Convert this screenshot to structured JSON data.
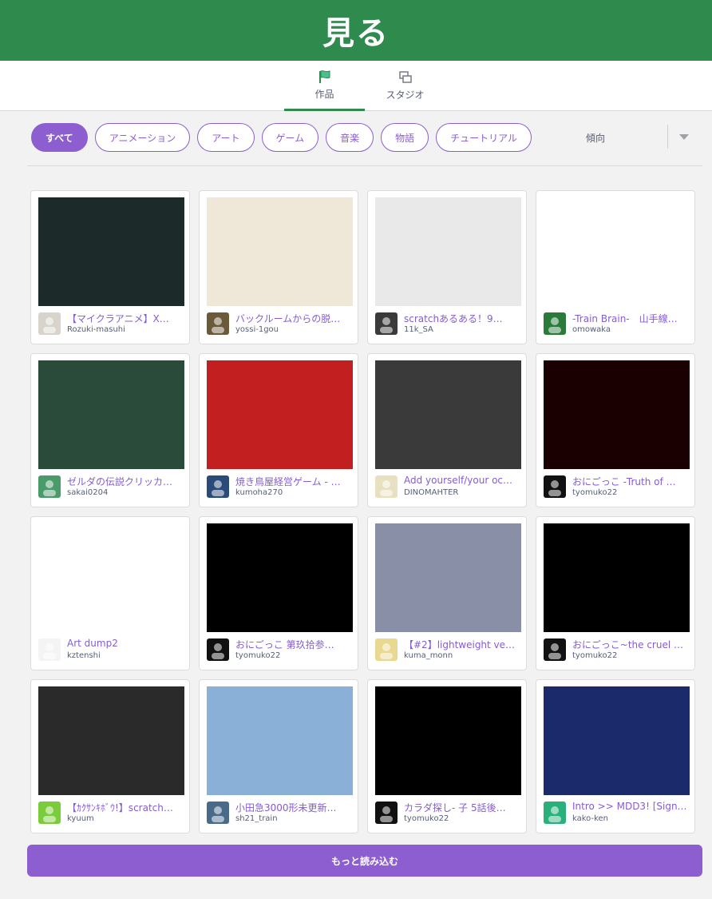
{
  "header": {
    "title": "見る"
  },
  "tabs": [
    {
      "label": "作品",
      "icon": "flag-icon",
      "active": true
    },
    {
      "label": "スタジオ",
      "icon": "studio-icon",
      "active": false
    }
  ],
  "filters": [
    {
      "label": "すべて",
      "active": true
    },
    {
      "label": "アニメーション",
      "active": false
    },
    {
      "label": "アート",
      "active": false
    },
    {
      "label": "ゲーム",
      "active": false
    },
    {
      "label": "音楽",
      "active": false
    },
    {
      "label": "物語",
      "active": false
    },
    {
      "label": "チュートリアル",
      "active": false
    }
  ],
  "sort": {
    "label": "傾向"
  },
  "projects": [
    {
      "title": "【マイクラアニメ】X…",
      "author": "Rozuki-masuhi",
      "thumb": "#1c2a2a",
      "avatar": "#d8d4cc"
    },
    {
      "title": "バックルームからの脱…",
      "author": "yossi-1gou",
      "thumb": "#efe8d8",
      "avatar": "#6b5a3a"
    },
    {
      "title": "scratchあるある！9…",
      "author": "11k_SA",
      "thumb": "#e9e9e9",
      "avatar": "#3a3a3a"
    },
    {
      "title": "-Train Brain-　山手線…",
      "author": "omowaka",
      "thumb": "#ffffff",
      "avatar": "#2a7a3a"
    },
    {
      "title": "ゼルダの伝説クリッカ…",
      "author": "sakai0204",
      "thumb": "#2a4a3a",
      "avatar": "#4a9a6a"
    },
    {
      "title": "焼き鳥屋経営ゲーム - …",
      "author": "kumoha270",
      "thumb": "#c22020",
      "avatar": "#2a4a7a"
    },
    {
      "title": "Add yourself/your oc…",
      "author": "DINOMAHTER",
      "thumb": "#3a3a3a",
      "avatar": "#e8e0c0"
    },
    {
      "title": "おにごっこ -Truth of …",
      "author": "tyomuko22",
      "thumb": "#1a0000",
      "avatar": "#111111"
    },
    {
      "title": "Art dump2",
      "author": "kztenshi",
      "thumb": "#ffffff",
      "avatar": "#f4f4f4"
    },
    {
      "title": "おにごっこ 第玖拾参…",
      "author": "tyomuko22",
      "thumb": "#000000",
      "avatar": "#111111"
    },
    {
      "title": "【#2】lightweight ve…",
      "author": "kuma_monn",
      "thumb": "#8a8fa8",
      "avatar": "#e8d890"
    },
    {
      "title": "おにごっこ~the cruel …",
      "author": "tyomuko22",
      "thumb": "#000000",
      "avatar": "#111111"
    },
    {
      "title": "【ｶｸｻﾝｷﾎﾞｳ!】scratch…",
      "author": "kyuum",
      "thumb": "#2a2a2a",
      "avatar": "#7acc3a"
    },
    {
      "title": "小田急3000形未更新…",
      "author": "sh21_train",
      "thumb": "#8ab0d8",
      "avatar": "#4a6a8a"
    },
    {
      "title": "カラダ探し- 子 5話後…",
      "author": "tyomuko22",
      "thumb": "#000000",
      "avatar": "#111111"
    },
    {
      "title": "Intro >> MDD3! [Sign…",
      "author": "kako-ken",
      "thumb": "#1a2a6a",
      "avatar": "#2ab07a"
    }
  ],
  "load_more": {
    "label": "もっと読み込む"
  },
  "colors": {
    "header_green": "#2e8a4d",
    "accent_purple": "#8c5ecf",
    "link_purple": "#855cd6"
  }
}
